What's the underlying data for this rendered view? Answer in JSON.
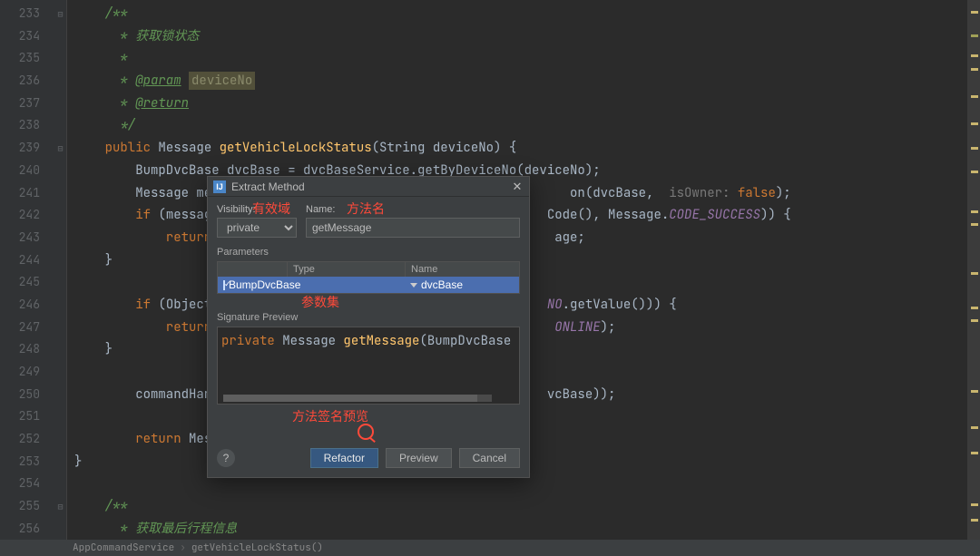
{
  "gutter": [
    "233",
    "234",
    "235",
    "236",
    "237",
    "238",
    "239",
    "240",
    "241",
    "242",
    "243",
    "244",
    "245",
    "246",
    "247",
    "248",
    "249",
    "250",
    "251",
    "252",
    "253",
    "254",
    "255",
    "256"
  ],
  "code": {
    "l233": "/**",
    "l234": " * 获取锁状态",
    "l235": " *",
    "l236_pre": " * ",
    "l236_tag": "@param",
    "l236_arg": "deviceNo",
    "l237_pre": " * ",
    "l237_tag": "@return",
    "l238": " */",
    "l239_kw": "public ",
    "l239_typ": "Message ",
    "l239_mth": "getVehicleLockStatus",
    "l239_post": "(String deviceNo) {",
    "l240_pre": "    BumpDvcBase dvcBase = ",
    "l240_svc": "dvcBaseService",
    "l240_dot": ".",
    "l240_call": "getByDeviceNo",
    "l240_post": "(deviceNo);",
    "l241_pre": "    Message me",
    "l241_tail_a": "on(dvcBase,  ",
    "l241_hint": "isOwner: ",
    "l241_tail_b": "false",
    "l241_tail_c": ");",
    "l242_pre": "    if (messag",
    "l242_tail_a": "Code(), Message.",
    "l242_const": "CODE_SUCCESS",
    "l242_tail_b": ")) {",
    "l243_pre": "        return",
    "l243_tail": "age;",
    "l244": "    }",
    "l246_pre": "    if (Object",
    "l246_tail_a": "NO",
    "l246_tail_b": ".getValue())) {",
    "l247_pre": "        return",
    "l247_tail_a": "ONLINE",
    "l247_tail_b": ");",
    "l248": "    }",
    "l250_pre": "    commandHan",
    "l250_tail": "vcBase));",
    "l252": "    return Mes",
    "l253": "}",
    "l255": "/**",
    "l256": " * 获取最后行程信息"
  },
  "dialog": {
    "title": "Extract Method",
    "visibility_label": "Visibility:",
    "visibility_value": "private",
    "name_label": "Name:",
    "name_value": "getMessage",
    "parameters_label": "Parameters",
    "param_hdr_type": "Type",
    "param_hdr_name": "Name",
    "param_row_type": "BumpDvcBase",
    "param_row_name": "dvcBase",
    "sigprev_label": "Signature Preview",
    "sig_kw": "private",
    "sig_typ": " Message ",
    "sig_mth": "getMessage",
    "sig_args": "(BumpDvcBase dvcB",
    "btn_refactor": "Refactor",
    "btn_preview": "Preview",
    "btn_cancel": "Cancel",
    "help": "?"
  },
  "annotations": {
    "scope": "有效域",
    "method_name": "方法名",
    "params": "参数集",
    "sig_preview": "方法签名预览"
  },
  "status": {
    "a": "AppCommandService",
    "b": "getVehicleLockStatus()"
  },
  "chart_data": null
}
